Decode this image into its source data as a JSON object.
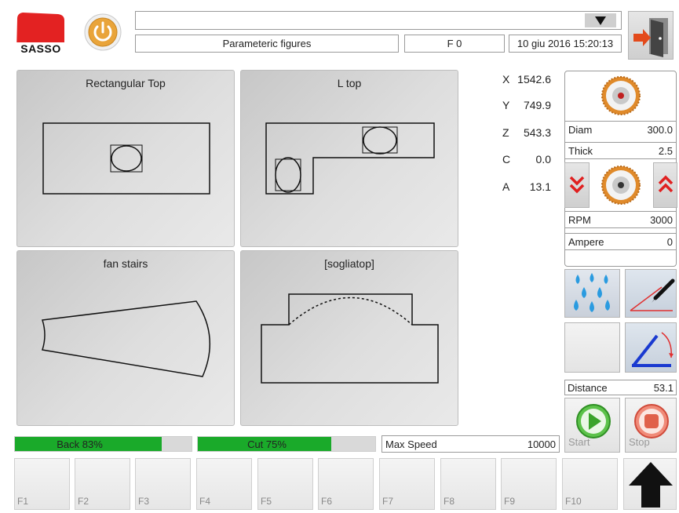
{
  "header": {
    "logo_text": "SASSO",
    "dropdown_value": "",
    "program_title": "Parameteric figures",
    "function_code": "F 0",
    "datetime": "10 giu 2016 15:20:13"
  },
  "figures": [
    {
      "label": "Rectangular Top"
    },
    {
      "label": "L top"
    },
    {
      "label": "fan stairs"
    },
    {
      "label": "[sogliatop]"
    }
  ],
  "axes": [
    {
      "name": "X",
      "value": "1542.6"
    },
    {
      "name": "Y",
      "value": "749.9"
    },
    {
      "name": "Z",
      "value": "543.3"
    },
    {
      "name": "C",
      "value": "0.0"
    },
    {
      "name": "A",
      "value": "13.1"
    }
  ],
  "blade": {
    "diam_label": "Diam",
    "diam_value": "300.0",
    "thick_label": "Thick",
    "thick_value": "2.5",
    "rpm_label": "RPM",
    "rpm_value": "3000",
    "ampere_label": "Ampere",
    "ampere_value": "0"
  },
  "distance": {
    "label": "Distance",
    "value": "53.1"
  },
  "controls": {
    "start_label": "Start",
    "stop_label": "Stop"
  },
  "progress": {
    "back_label": "Back 83%",
    "back_fraction": 0.83,
    "cut_label": "Cut 75%",
    "cut_fraction": 0.75
  },
  "max_speed": {
    "label": "Max Speed",
    "value": "10000"
  },
  "function_keys": [
    "F1",
    "F2",
    "F3",
    "F4",
    "F5",
    "F6",
    "F7",
    "F8",
    "F9",
    "F10"
  ],
  "colors": {
    "accent_green": "#1aaa2a",
    "logo_red": "#e32222",
    "power_orange": "#e9a43a"
  }
}
